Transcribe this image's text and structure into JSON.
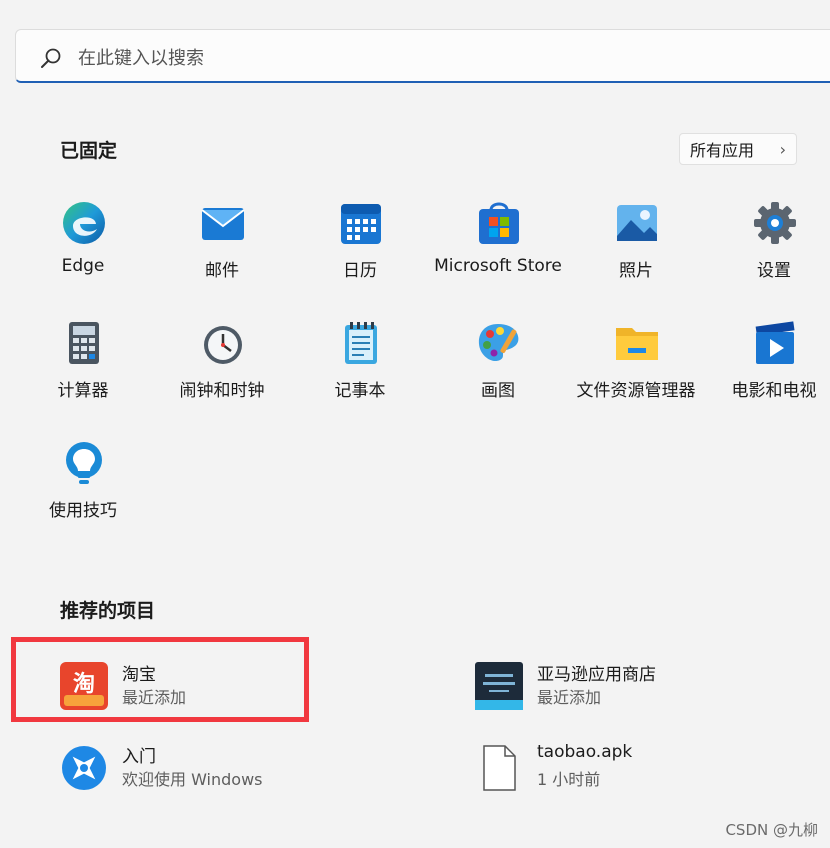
{
  "search": {
    "placeholder": "在此键入以搜索"
  },
  "pinned": {
    "title": "已固定",
    "all_apps_label": "所有应用",
    "apps": [
      {
        "label": "Edge",
        "icon": "edge-icon"
      },
      {
        "label": "邮件",
        "icon": "mail-icon"
      },
      {
        "label": "日历",
        "icon": "calendar-icon"
      },
      {
        "label": "Microsoft Store",
        "icon": "store-icon"
      },
      {
        "label": "照片",
        "icon": "photos-icon"
      },
      {
        "label": "设置",
        "icon": "gear-icon"
      },
      {
        "label": "计算器",
        "icon": "calculator-icon"
      },
      {
        "label": "闹钟和时钟",
        "icon": "alarm-clock-icon"
      },
      {
        "label": "记事本",
        "icon": "notepad-icon"
      },
      {
        "label": "画图",
        "icon": "paint-icon"
      },
      {
        "label": "文件资源管理器",
        "icon": "folder-icon"
      },
      {
        "label": "电影和电视",
        "icon": "movies-icon"
      },
      {
        "label": "使用技巧",
        "icon": "tips-icon"
      }
    ]
  },
  "recommended": {
    "title": "推荐的项目",
    "items": [
      {
        "title": "淘宝",
        "subtitle": "最近添加",
        "icon": "taobao-icon"
      },
      {
        "title": "亚马逊应用商店",
        "subtitle": "最近添加",
        "icon": "amazon-appstore-icon"
      },
      {
        "title": "入门",
        "subtitle": "欢迎使用 Windows",
        "icon": "get-started-icon"
      },
      {
        "title": "taobao.apk",
        "subtitle": "1 小时前",
        "icon": "file-icon"
      }
    ]
  },
  "watermark": "CSDN @九柳",
  "colors": {
    "accent": "#1f5fb4",
    "highlight": "#f1383f"
  }
}
